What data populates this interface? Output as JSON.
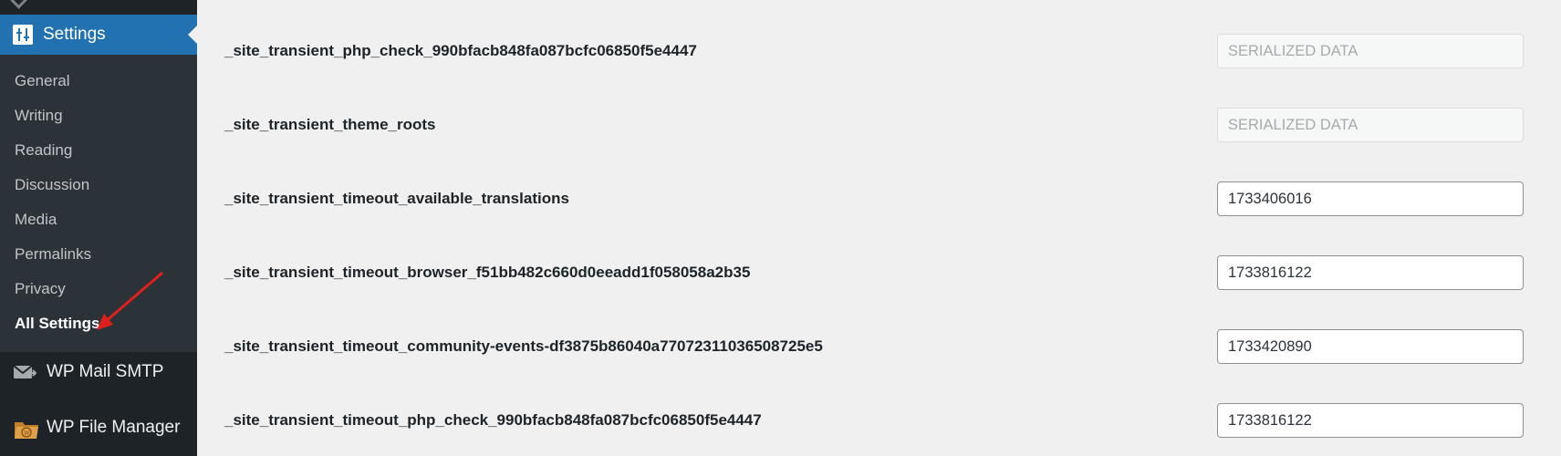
{
  "sidebar": {
    "settings_label": "Settings",
    "submenu": [
      {
        "label": "General"
      },
      {
        "label": "Writing"
      },
      {
        "label": "Reading"
      },
      {
        "label": "Discussion"
      },
      {
        "label": "Media"
      },
      {
        "label": "Permalinks"
      },
      {
        "label": "Privacy"
      },
      {
        "label": "All Settings",
        "current": true
      }
    ],
    "wp_mail_smtp_label": "WP Mail SMTP",
    "wp_file_manager_label": "WP File Manager"
  },
  "options": [
    {
      "name": "_site_transient_php_check_990bfacb848fa087bcfc06850f5e4447",
      "value": "SERIALIZED DATA",
      "readonly": true
    },
    {
      "name": "_site_transient_theme_roots",
      "value": "SERIALIZED DATA",
      "readonly": true
    },
    {
      "name": "_site_transient_timeout_available_translations",
      "value": "1733406016",
      "readonly": false
    },
    {
      "name": "_site_transient_timeout_browser_f51bb482c660d0eeadd1f058058a2b35",
      "value": "1733816122",
      "readonly": false
    },
    {
      "name": "_site_transient_timeout_community-events-df3875b86040a77072311036508725e5",
      "value": "1733420890",
      "readonly": false
    },
    {
      "name": "_site_transient_timeout_php_check_990bfacb848fa087bcfc06850f5e4447",
      "value": "1733816122",
      "readonly": false
    }
  ],
  "colors": {
    "sidebar_bg": "#1d2327",
    "submenu_bg": "#2c3338",
    "accent": "#2271b1",
    "annotation": "#e0201b"
  },
  "icons": [
    "settings-icon",
    "wp-mail-smtp-icon",
    "wp-file-manager-icon",
    "annotation-arrow-icon"
  ]
}
